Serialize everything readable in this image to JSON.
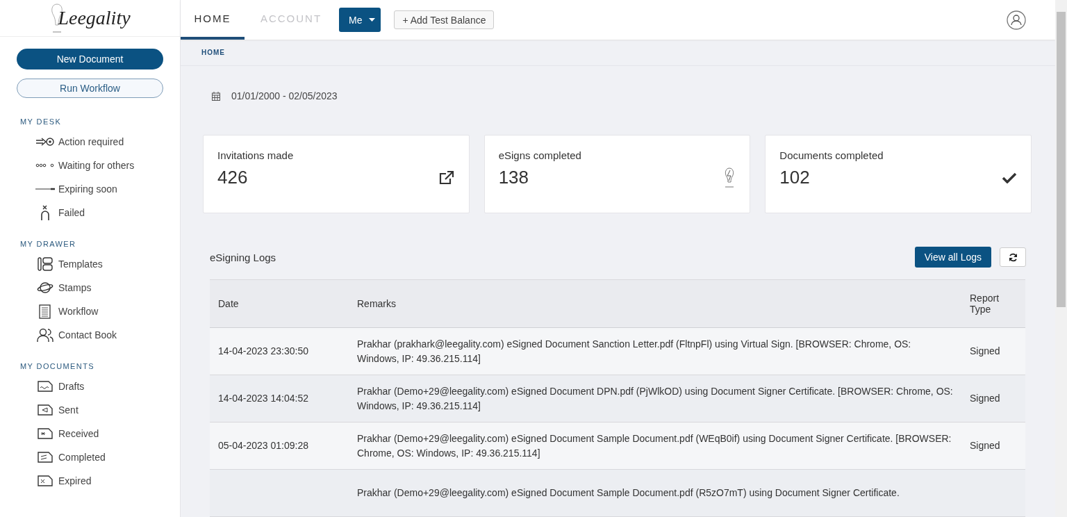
{
  "logo": {
    "text": "Leegality"
  },
  "sidebar": {
    "primary_button": "New Document",
    "secondary_button": "Run Workflow",
    "sections": [
      {
        "title": "MY DESK",
        "items": [
          {
            "label": "Action required"
          },
          {
            "label": "Waiting for others"
          },
          {
            "label": "Expiring soon"
          },
          {
            "label": "Failed"
          }
        ]
      },
      {
        "title": "MY DRAWER",
        "items": [
          {
            "label": "Templates"
          },
          {
            "label": "Stamps"
          },
          {
            "label": "Workflow"
          },
          {
            "label": "Contact Book"
          }
        ]
      },
      {
        "title": "MY DOCUMENTS",
        "items": [
          {
            "label": "Drafts"
          },
          {
            "label": "Sent"
          },
          {
            "label": "Received"
          },
          {
            "label": "Completed"
          },
          {
            "label": "Expired"
          }
        ]
      }
    ]
  },
  "tabs": [
    {
      "label": "HOME",
      "selected": true
    },
    {
      "label": "ACCOUNT",
      "selected": false
    }
  ],
  "user_menu": {
    "label": "Me"
  },
  "add_balance_button": "+ Add Test Balance",
  "breadcrumb": "HOME",
  "date_range": "01/01/2000 - 02/05/2023",
  "stats": [
    {
      "label": "Invitations made",
      "value": "426"
    },
    {
      "label": "eSigns completed",
      "value": "138"
    },
    {
      "label": "Documents completed",
      "value": "102"
    }
  ],
  "logs": {
    "title": "eSigning Logs",
    "view_all_button": "View all Logs",
    "columns": [
      "Date",
      "Remarks",
      "Report Type"
    ],
    "rows": [
      {
        "date": "14-04-2023 23:30:50",
        "remarks": "Prakhar (prakhark@leegality.com) eSigned Document Sanction Letter.pdf (FltnpFl) using Virtual Sign. [BROWSER: Chrome, OS: Windows, IP: 49.36.215.114]",
        "type": "Signed"
      },
      {
        "date": "14-04-2023 14:04:52",
        "remarks": "Prakhar (Demo+29@leegality.com) eSigned Document DPN.pdf (PjWlkOD) using Document Signer Certificate. [BROWSER: Chrome, OS: Windows, IP: 49.36.215.114]",
        "type": "Signed"
      },
      {
        "date": "05-04-2023 01:09:28",
        "remarks": "Prakhar (Demo+29@leegality.com) eSigned Document Sample Document.pdf (WEqB0if) using Document Signer Certificate. [BROWSER: Chrome, OS: Windows, IP: 49.36.215.114]",
        "type": "Signed"
      },
      {
        "date": "",
        "remarks": "Prakhar (Demo+29@leegality.com) eSigned Document Sample Document.pdf (R5zO7mT) using Document Signer Certificate.",
        "type": ""
      }
    ]
  }
}
